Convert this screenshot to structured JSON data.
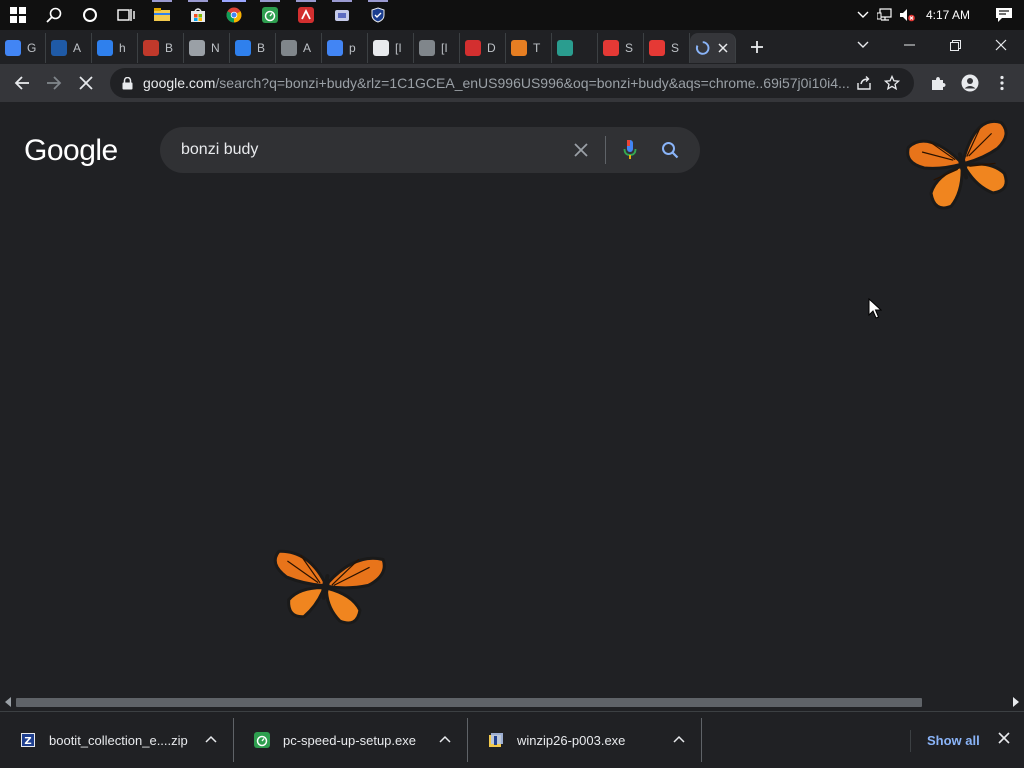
{
  "taskbar": {
    "clock": "4:17 AM",
    "apps": [
      "start-icon",
      "search-icon",
      "cortana-icon",
      "task-view-icon",
      "file-explorer-icon",
      "store-icon",
      "chrome-icon",
      "pc-speed-up-icon",
      "avira-icon",
      "app-icon",
      "shield-app-icon"
    ]
  },
  "tabs": [
    {
      "label": "G",
      "icon": "google-icon",
      "color": "#4285f4"
    },
    {
      "label": "A",
      "icon": "wa-icon",
      "color": "#1f5aa6"
    },
    {
      "label": "h",
      "icon": "slash-icon",
      "color": "#2f80ed"
    },
    {
      "label": "B",
      "icon": "bag-icon",
      "color": "#c0392b"
    },
    {
      "label": "N",
      "icon": "chromium-icon",
      "color": "#9aa0a6"
    },
    {
      "label": "B",
      "icon": "slash-icon",
      "color": "#2f80ed"
    },
    {
      "label": "A",
      "icon": "globe-icon",
      "color": "#80868b"
    },
    {
      "label": "p",
      "icon": "google-icon",
      "color": "#4285f4"
    },
    {
      "label": "[I",
      "icon": "gear-icon",
      "color": "#e8eaed"
    },
    {
      "label": "[I",
      "icon": "globe-icon",
      "color": "#80868b"
    },
    {
      "label": "D",
      "icon": "avira-icon",
      "color": "#d32f2f"
    },
    {
      "label": "T",
      "icon": "cloud-icon",
      "color": "#e67e22"
    },
    {
      "label": "",
      "icon": "photo-icon",
      "color": "#2a9d8f"
    },
    {
      "label": "S",
      "icon": "s-icon",
      "color": "#e53935"
    },
    {
      "label": "S",
      "icon": "s-icon",
      "color": "#e53935"
    }
  ],
  "toolbar": {
    "url_domain": "google.com",
    "url_path": "/search?q=bonzi+budy&rlz=1C1GCEA_enUS996US996&oq=bonzi+budy&aqs=chrome..69i57j0i10i4..."
  },
  "page": {
    "logo": "Google",
    "query": "bonzi budy"
  },
  "downloads": {
    "items": [
      {
        "name": "bootit_collection_e....zip",
        "icon": "zip-icon"
      },
      {
        "name": "pc-speed-up-setup.exe",
        "icon": "pc-speed-up-icon"
      },
      {
        "name": "winzip26-p003.exe",
        "icon": "winzip-icon"
      }
    ],
    "show_all": "Show all"
  },
  "colors": {
    "background": "#202124",
    "toolbar": "#35363a",
    "accent_link": "#8ab4f8"
  }
}
